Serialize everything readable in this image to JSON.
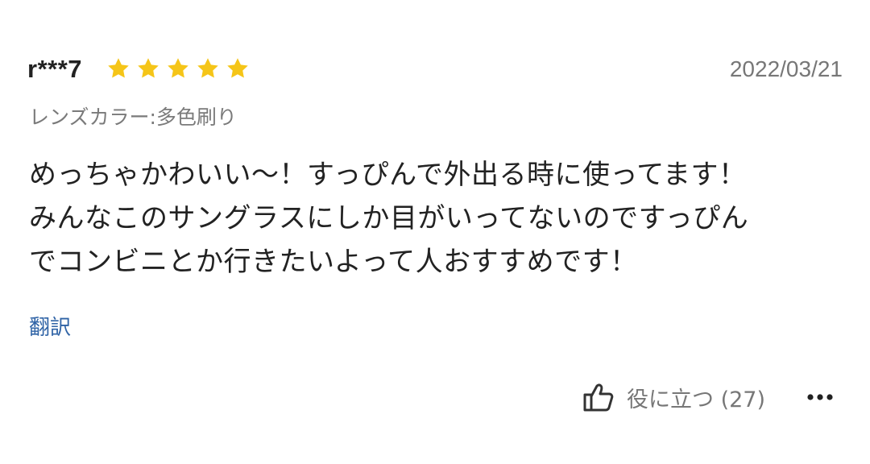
{
  "review": {
    "username": "r***7",
    "rating": 5,
    "rating_max": 5,
    "date": "2022/03/21",
    "variant": "レンズカラー:多色刷り",
    "body_lines": [
      "めっちゃかわいい〜！すっぴんで外出る時に使ってます！",
      "みんなこのサングラスにしか目がいってないのですっぴん",
      "でコンビニとか行きたいよって人おすすめです！"
    ],
    "translate_label": "翻訳",
    "helpful_label": "役に立つ (27)",
    "icons": {
      "star": "star-icon",
      "helpful": "thumbs-up-icon",
      "more": "more-icon"
    },
    "colors": {
      "star": "#F5C518",
      "link": "#2F63A6",
      "muted": "#777777",
      "text": "#222222"
    }
  }
}
